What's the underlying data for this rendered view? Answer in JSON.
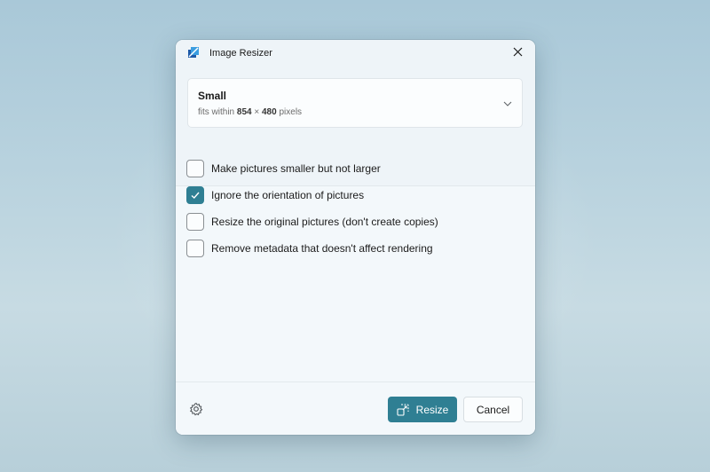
{
  "window": {
    "title": "Image Resizer",
    "app_icon": "image-resizer-icon",
    "close_icon": "close-icon"
  },
  "preset": {
    "name": "Small",
    "description_prefix": "fits within",
    "width": "854",
    "times": "×",
    "height": "480",
    "unit": "pixels",
    "chevron_icon": "chevron-down-icon"
  },
  "options": [
    {
      "label": "Make pictures smaller but not larger",
      "checked": false
    },
    {
      "label": "Ignore the orientation of pictures",
      "checked": true
    },
    {
      "label": "Resize the original pictures (don't create copies)",
      "checked": false
    },
    {
      "label": "Remove metadata that doesn't affect rendering",
      "checked": false
    }
  ],
  "footer": {
    "settings_icon": "gear-icon",
    "resize_label": "Resize",
    "resize_icon": "resize-icon",
    "cancel_label": "Cancel"
  },
  "colors": {
    "accent": "#2f7f93",
    "window_bg": "#f3f8fb"
  }
}
